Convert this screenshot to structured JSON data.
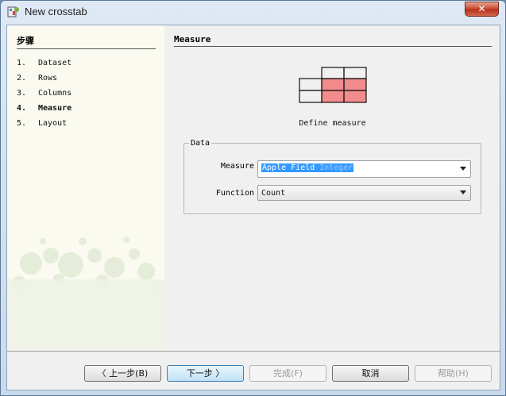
{
  "window": {
    "title": "New crosstab",
    "close_glyph": "✕",
    "app_icon": "crosstab-app-icon"
  },
  "steps": {
    "title": "步骤",
    "items": [
      {
        "num": "1.",
        "label": "Dataset"
      },
      {
        "num": "2.",
        "label": "Rows"
      },
      {
        "num": "3.",
        "label": "Columns"
      },
      {
        "num": "4.",
        "label": "Measure"
      },
      {
        "num": "5.",
        "label": "Layout"
      }
    ],
    "active_index": 3
  },
  "main": {
    "section_title": "Measure",
    "define_label": "Define measure",
    "group_title": "Data",
    "measure": {
      "label": "Measure",
      "value": "Apple  Field",
      "value_type": "Integer"
    },
    "function": {
      "label": "Function",
      "value": "Count"
    }
  },
  "buttons": {
    "back": "〈 上一步(B)",
    "next": "下一步 〉",
    "finish": "完成(F)",
    "cancel": "取消",
    "help": "帮助(H)"
  },
  "colors": {
    "highlight_cell": "#f28b8b",
    "selection": "#3399ff"
  }
}
